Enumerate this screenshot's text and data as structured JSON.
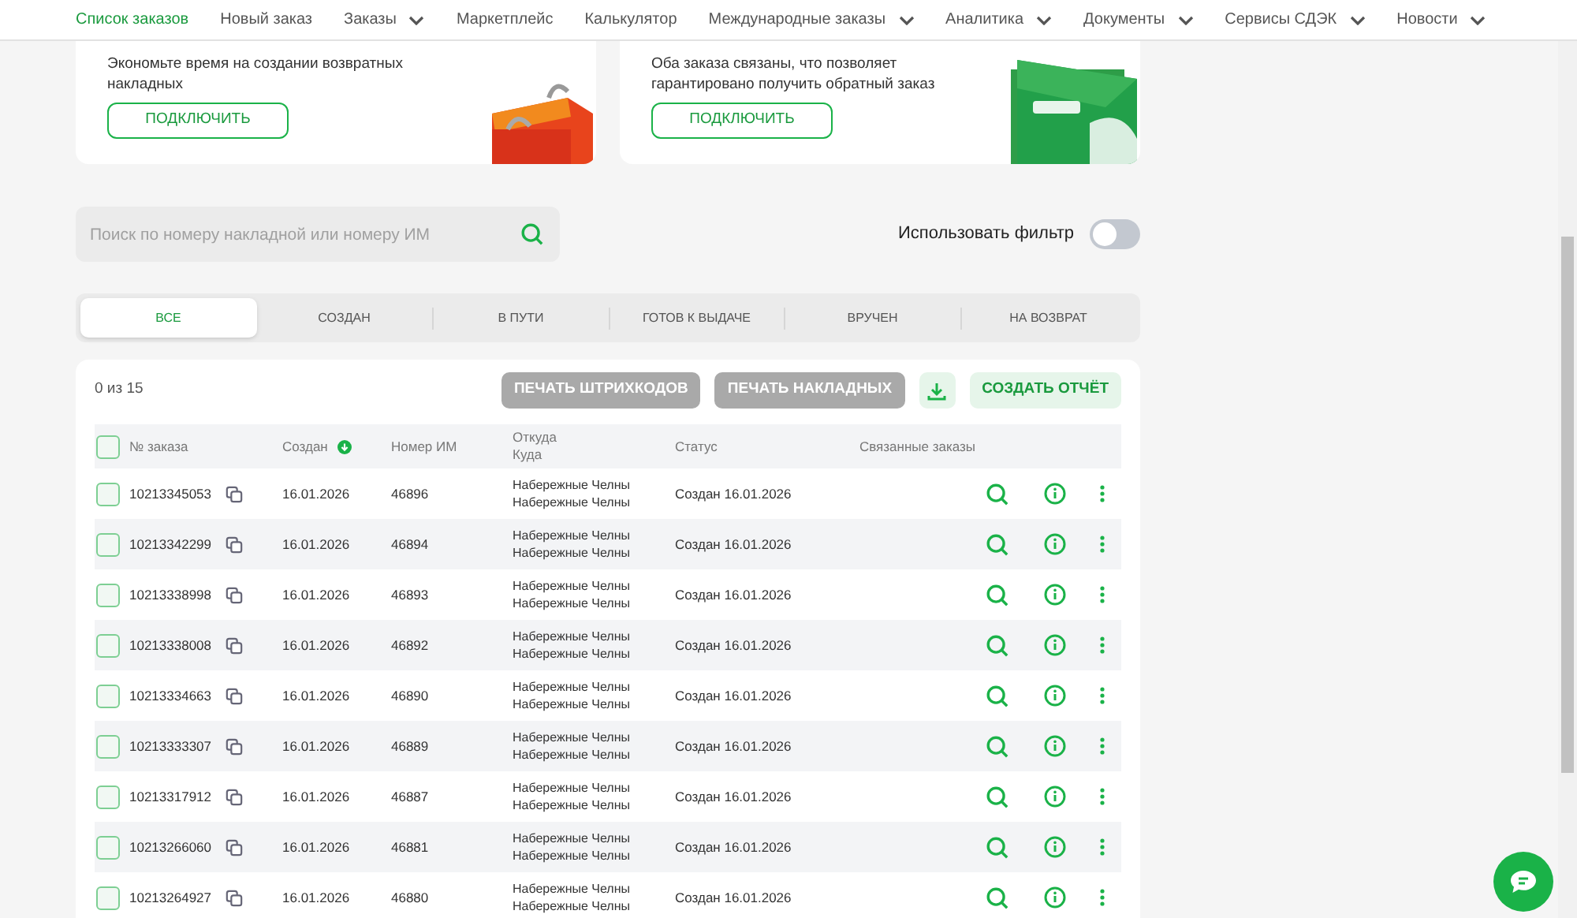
{
  "nav": [
    {
      "label": "Список заказов",
      "selected": true,
      "dropdown": false
    },
    {
      "label": "Новый заказ",
      "selected": false,
      "dropdown": false
    },
    {
      "label": "Заказы",
      "selected": false,
      "dropdown": true
    },
    {
      "label": "Маркетплейс",
      "selected": false,
      "dropdown": false
    },
    {
      "label": "Калькулятор",
      "selected": false,
      "dropdown": false
    },
    {
      "label": "Международные заказы",
      "selected": false,
      "dropdown": true
    },
    {
      "label": "Аналитика",
      "selected": false,
      "dropdown": true
    },
    {
      "label": "Документы",
      "selected": false,
      "dropdown": true
    },
    {
      "label": "Сервисы СДЭК",
      "selected": false,
      "dropdown": true
    },
    {
      "label": "Новости",
      "selected": false,
      "dropdown": true
    }
  ],
  "promos": [
    {
      "text": "Экономьте время на создании возвратных накладных",
      "button": "ПОДКЛЮЧИТЬ",
      "kind": "bag"
    },
    {
      "text": "Оба заказа связаны, что позволяет гарантировано получить обратный заказ",
      "button": "ПОДКЛЮЧИТЬ",
      "kind": "envelope"
    }
  ],
  "search": {
    "placeholder": "Поиск по номеру накладной или номеру ИМ"
  },
  "filter": {
    "label": "Использовать фильтр",
    "on": false
  },
  "tabs": [
    {
      "label": "ВСЕ",
      "selected": true
    },
    {
      "label": "СОЗДАН",
      "selected": false
    },
    {
      "label": "В ПУТИ",
      "selected": false
    },
    {
      "label": "ГОТОВ К ВЫДАЧЕ",
      "selected": false
    },
    {
      "label": "ВРУЧЕН",
      "selected": false
    },
    {
      "label": "НА ВОЗВРАТ",
      "selected": false
    }
  ],
  "count": "0 из 15",
  "actions": {
    "print_barcodes": "ПЕЧАТЬ ШТРИХКОДОВ",
    "print_waybills": "ПЕЧАТЬ НАКЛАДНЫХ",
    "report": "СОЗДАТЬ ОТЧЁТ"
  },
  "table": {
    "select_all_checked": false,
    "columns": [
      "№ заказа",
      "Создан",
      "Номер ИМ",
      "Откуда",
      "Куда",
      "Статус",
      "Связанные заказы"
    ],
    "rows": [
      {
        "number": "10213345053",
        "created": "16.01.2026",
        "im": "46896",
        "from": "Набережные Челны",
        "to": "Набережные Челны",
        "status": "Создан 16.01.2026",
        "checked": false
      },
      {
        "number": "10213342299",
        "created": "16.01.2026",
        "im": "46894",
        "from": "Набережные Челны",
        "to": "Набережные Челны",
        "status": "Создан 16.01.2026",
        "checked": false
      },
      {
        "number": "10213338998",
        "created": "16.01.2026",
        "im": "46893",
        "from": "Набережные Челны",
        "to": "Набережные Челны",
        "status": "Создан 16.01.2026",
        "checked": false
      },
      {
        "number": "10213338008",
        "created": "16.01.2026",
        "im": "46892",
        "from": "Набережные Челны",
        "to": "Набережные Челны",
        "status": "Создан 16.01.2026",
        "checked": false
      },
      {
        "number": "10213334663",
        "created": "16.01.2026",
        "im": "46890",
        "from": "Набережные Челны",
        "to": "Набережные Челны",
        "status": "Создан 16.01.2026",
        "checked": false
      },
      {
        "number": "10213333307",
        "created": "16.01.2026",
        "im": "46889",
        "from": "Набережные Челны",
        "to": "Набережные Челны",
        "status": "Создан 16.01.2026",
        "checked": false
      },
      {
        "number": "10213317912",
        "created": "16.01.2026",
        "im": "46887",
        "from": "Набережные Челны",
        "to": "Набережные Челны",
        "status": "Создан 16.01.2026",
        "checked": false
      },
      {
        "number": "10213266060",
        "created": "16.01.2026",
        "im": "46881",
        "from": "Набережные Челны",
        "to": "Набережные Челны",
        "status": "Создан 16.01.2026",
        "checked": false
      },
      {
        "number": "10213264927",
        "created": "16.01.2026",
        "im": "46880",
        "from": "Набережные Челны",
        "to": "Набережные Челны",
        "status": "Создан 16.01.2026",
        "checked": false
      }
    ]
  }
}
